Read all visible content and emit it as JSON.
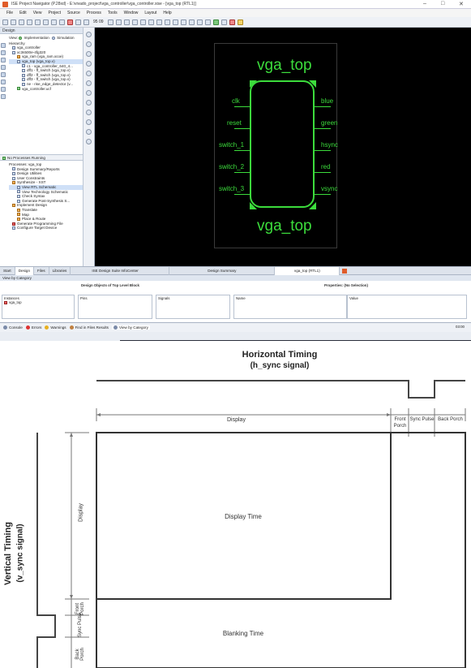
{
  "ise": {
    "window_title": "ISE Project Navigator (P.28xd) - E:\\vivado_project\\vga_controller\\vga_controller.xise - [vga_top (RTL1)]",
    "window_controls": [
      "–",
      "□",
      "✕"
    ],
    "menu": [
      "File",
      "Edit",
      "View",
      "Project",
      "Source",
      "Process",
      "Tools",
      "Window",
      "Layout",
      "Help"
    ],
    "toolbar_zoom": "95 09",
    "design_panel": {
      "header": "Design",
      "view_label": "View:",
      "implementation_label": "Implementation",
      "simulation_label": "Simulation",
      "hierarchy_label": "Hierarchy",
      "tree": [
        "vga_controller",
        "xc3s500e-4fg320",
        "vga_ram (vga_ram.xcoe)",
        "vga_top (vga_top.v)",
        "c1 - vga_controller_640_4...",
        "dff1 - ff_switch (vga_top.v)",
        "dff2 - ff_switch (vga_top.v)",
        "dff3 - ff_switch (vga_top.v)",
        "ne - rise_edge_detector (v...",
        "vga_controller.ucf"
      ]
    },
    "process_panel": {
      "status": "No Processes Running",
      "processes_label": "Processes: vga_top",
      "items": [
        "Design Summary/Reports",
        "Design Utilities",
        "User Constraints",
        "Synthesize - XST",
        "View RTL Schematic",
        "View Technology Schematic",
        "Check Syntax",
        "Generate Post-Synthesis S...",
        "Implement Design",
        "Translate",
        "Map",
        "Place & Route",
        "Generate Programming File",
        "Configure Target Device"
      ]
    },
    "schematic": {
      "title_top": "vga_top",
      "title_bottom": "vga_top",
      "inputs": [
        "clk",
        "reset",
        "switch_1",
        "switch_2",
        "switch_3"
      ],
      "outputs": [
        "blue",
        "green",
        "hsync",
        "red",
        "vsync"
      ],
      "color": "#3cdc3c"
    },
    "left_tabs": [
      "Start",
      "Design",
      "Files",
      "Libraries"
    ],
    "editor_tabs": [
      "ISE Design Suite InfoCenter",
      "Design Summary",
      "vga_top (RTL1)"
    ],
    "view_by_category": {
      "header": "View by Category",
      "objects_header": "Design Objects of Top Level Block",
      "properties_header": "Properties: (No Selection)",
      "columns": [
        "Instances",
        "Pins",
        "Signals",
        "Name",
        "Value"
      ],
      "instance": "vga_top"
    },
    "status_tabs": [
      "Console",
      "Errors",
      "Warnings",
      "Find in Files Results",
      "View by Category"
    ],
    "taskbar_time": "03:00"
  },
  "diagram": {
    "horizontal_title": "Horizontal Timing",
    "horizontal_subtitle": "(h_sync signal)",
    "vertical_title": "Vertical Timing",
    "vertical_subtitle": "(v_sync signal)",
    "h_segments": [
      "Display",
      "Front Porch",
      "Sync Pulse",
      "Back Porch"
    ],
    "v_segments": [
      "Display",
      "Front Porch",
      "Sync Pulse",
      "Back Porch"
    ],
    "display_time": "Display Time",
    "blanking_time": "Blanking Time"
  }
}
